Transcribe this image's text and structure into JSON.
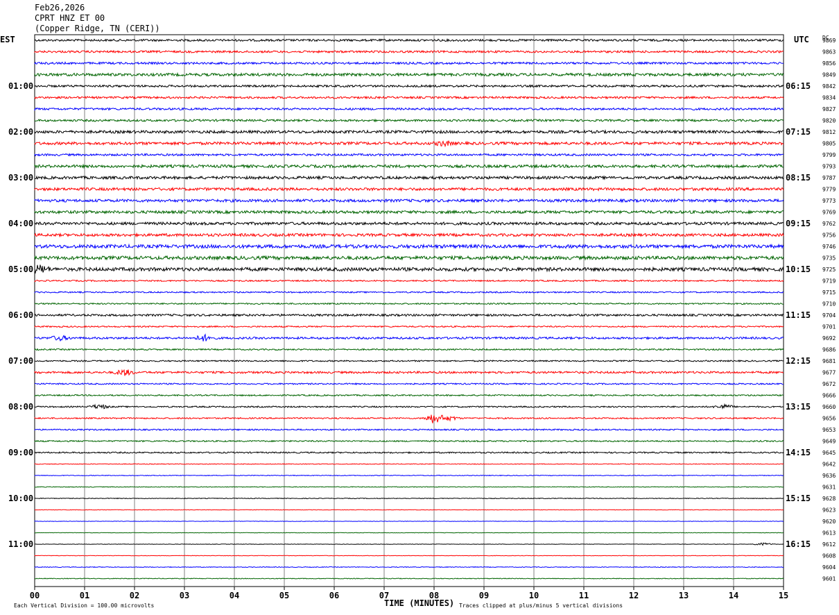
{
  "header": {
    "date": "Feb26,2026",
    "station": "CPRT HNZ ET 00",
    "location": "(Copper Ridge, TN (CERI))"
  },
  "chart_data": {
    "type": "line",
    "subtype": "helicorder",
    "left_timezone": "EST",
    "right_timezone": "UTC",
    "dc_label": "DC",
    "minutes_per_line": 15,
    "colors": [
      "#000000",
      "#ff0000",
      "#0000ff",
      "#006400"
    ],
    "xlabel": "TIME (MINUTES)",
    "x_ticks": [
      "00",
      "01",
      "02",
      "03",
      "04",
      "05",
      "06",
      "07",
      "08",
      "09",
      "10",
      "11",
      "12",
      "13",
      "14",
      "15"
    ],
    "left_hour_labels": [
      "01:00",
      "02:00",
      "03:00",
      "04:00",
      "05:00",
      "06:00",
      "07:00",
      "08:00",
      "09:00",
      "10:00",
      "11:00"
    ],
    "right_hour_labels": [
      "06:15",
      "07:15",
      "08:15",
      "09:15",
      "10:15",
      "11:15",
      "12:15",
      "13:15",
      "14:15",
      "15:15",
      "16:15"
    ],
    "dc_values": [
      9869,
      9863,
      9856,
      9849,
      9842,
      9834,
      9827,
      9820,
      9812,
      9805,
      9799,
      9793,
      9787,
      9779,
      9773,
      9769,
      9762,
      9756,
      9746,
      9735,
      9725,
      9719,
      9715,
      9710,
      9704,
      9701,
      9692,
      9686,
      9681,
      9677,
      9672,
      9666,
      9660,
      9656,
      9653,
      9649,
      9645,
      9642,
      9636,
      9631,
      9628,
      9623,
      9620,
      9613,
      9612,
      9608,
      9604,
      9601
    ],
    "noise_amplitude": [
      1.5,
      1.5,
      1.5,
      2,
      1.5,
      1.5,
      1.5,
      1.5,
      2,
      2,
      1.5,
      2,
      2,
      2,
      2,
      2,
      2,
      2,
      2.5,
      2.5,
      2.5,
      1,
      1,
      1,
      1.5,
      1,
      1.5,
      1,
      1,
      1.5,
      1,
      1,
      1,
      1,
      1,
      1,
      1,
      0.5,
      0.5,
      0.5,
      0.5,
      0.3,
      0.3,
      0.3,
      0.3,
      0.3,
      0.5,
      0.5
    ],
    "events": [
      {
        "trace": 20,
        "minute": 0.1,
        "amplitude": 5
      },
      {
        "trace": 33,
        "minute": 8.0,
        "amplitude": 7
      },
      {
        "trace": 33,
        "minute": 8.3,
        "amplitude": 3
      },
      {
        "trace": 29,
        "minute": 1.8,
        "amplitude": 4
      },
      {
        "trace": 26,
        "minute": 0.5,
        "amplitude": 3
      },
      {
        "trace": 26,
        "minute": 3.4,
        "amplitude": 4
      },
      {
        "trace": 32,
        "minute": 13.8,
        "amplitude": 3
      },
      {
        "trace": 32,
        "minute": 1.3,
        "amplitude": 3
      },
      {
        "trace": 9,
        "minute": 8.2,
        "amplitude": 3
      },
      {
        "trace": 44,
        "minute": 14.6,
        "amplitude": 2
      }
    ],
    "footnote_left": "Each Vertical Division =  100.00 microvolts",
    "footnote_right": "Traces clipped at plus/minus 5 vertical divisions"
  }
}
